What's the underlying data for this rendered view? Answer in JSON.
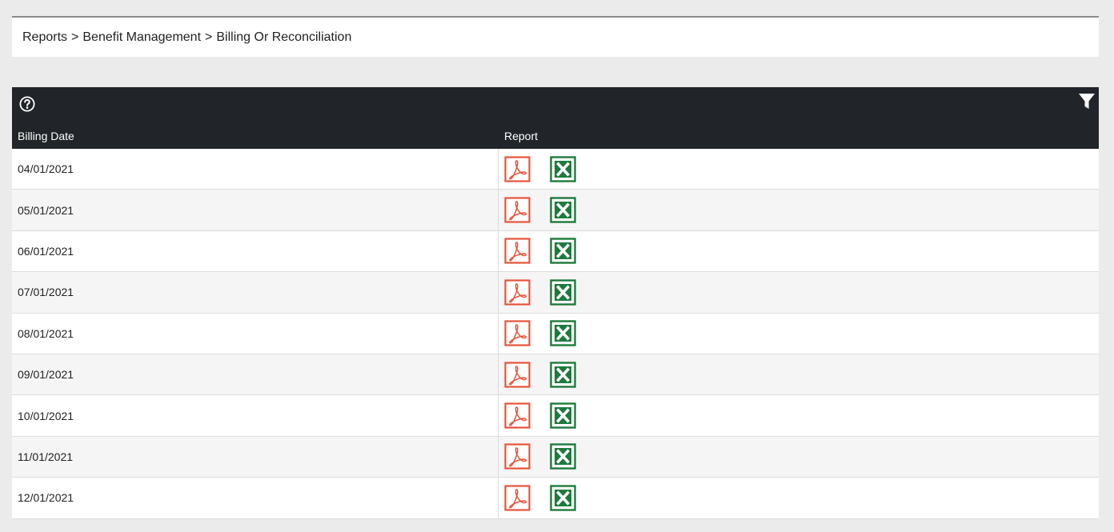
{
  "breadcrumb": {
    "items": [
      "Reports",
      "Benefit Management",
      "Billing Or Reconciliation"
    ],
    "separator": ">"
  },
  "toolbar": {
    "help_icon": "help-circle-icon",
    "filter_icon": "filter-icon"
  },
  "table": {
    "columns": {
      "billing_date": "Billing Date",
      "report": "Report"
    },
    "rows": [
      {
        "date": "04/01/2021"
      },
      {
        "date": "05/01/2021"
      },
      {
        "date": "06/01/2021"
      },
      {
        "date": "07/01/2021"
      },
      {
        "date": "08/01/2021"
      },
      {
        "date": "09/01/2021"
      },
      {
        "date": "10/01/2021"
      },
      {
        "date": "11/01/2021"
      },
      {
        "date": "12/01/2021"
      }
    ],
    "icons": {
      "pdf": "pdf-icon",
      "excel": "excel-icon"
    }
  },
  "colors": {
    "header_bg": "#212428",
    "pdf": "#e8533a",
    "excel": "#1e7a3c",
    "page_bg": "#ebebeb"
  }
}
